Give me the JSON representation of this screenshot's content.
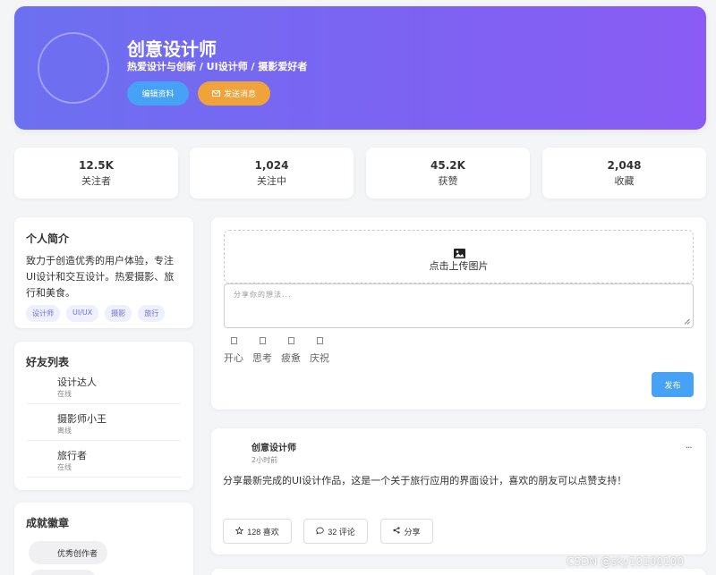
{
  "profile": {
    "name": "创意设计师",
    "tagline": "热爱设计与创新 / UI设计师 / 摄影爱好者",
    "edit_button": "编辑资料",
    "message_button": "发送消息"
  },
  "stats": [
    {
      "value": "12.5K",
      "label": "关注者"
    },
    {
      "value": "1,024",
      "label": "关注中"
    },
    {
      "value": "45.2K",
      "label": "获赞"
    },
    {
      "value": "2,048",
      "label": "收藏"
    }
  ],
  "bio": {
    "title": "个人简介",
    "text": "致力于创造优秀的用户体验，专注UI设计和交互设计。热爱摄影、旅行和美食。",
    "tags": [
      "设计师",
      "UI/UX",
      "摄影",
      "旅行"
    ]
  },
  "friends": {
    "title": "好友列表",
    "items": [
      {
        "name": "设计达人",
        "status": "在线"
      },
      {
        "name": "摄影师小王",
        "status": "离线"
      },
      {
        "name": "旅行者",
        "status": "在线"
      }
    ]
  },
  "badges": {
    "title": "成就徽章",
    "items": [
      "优秀创作者"
    ]
  },
  "composer": {
    "upload_label": "点击上传图片",
    "placeholder": "分享你的想法...",
    "moods": [
      "开心",
      "思考",
      "疲惫",
      "庆祝"
    ],
    "publish_button": "发布"
  },
  "post": {
    "author": "创意设计师",
    "time": "2小时前",
    "menu": "···",
    "text": "分享最新完成的UI设计作品，这是一个关于旅行应用的界面设计，喜欢的朋友可以点赞支持！",
    "like_label": "128 喜欢",
    "comment_label": "32 评论",
    "share_label": "分享"
  },
  "watermark": "CSDN @sky10100100",
  "colors": {
    "header_gradient_start": "#6c70f0",
    "header_gradient_end": "#8a5cf5",
    "primary_button": "#45a2f5",
    "secondary_button": "#f0a33a",
    "tag_text": "#6b6fe0",
    "page_background": "#f4f5f7"
  },
  "icons": {
    "message_button_icon": "envelope-icon",
    "upload_icon": "image-icon",
    "like_icon": "star-icon",
    "comment_icon": "comment-icon",
    "share_icon": "share-icon"
  }
}
